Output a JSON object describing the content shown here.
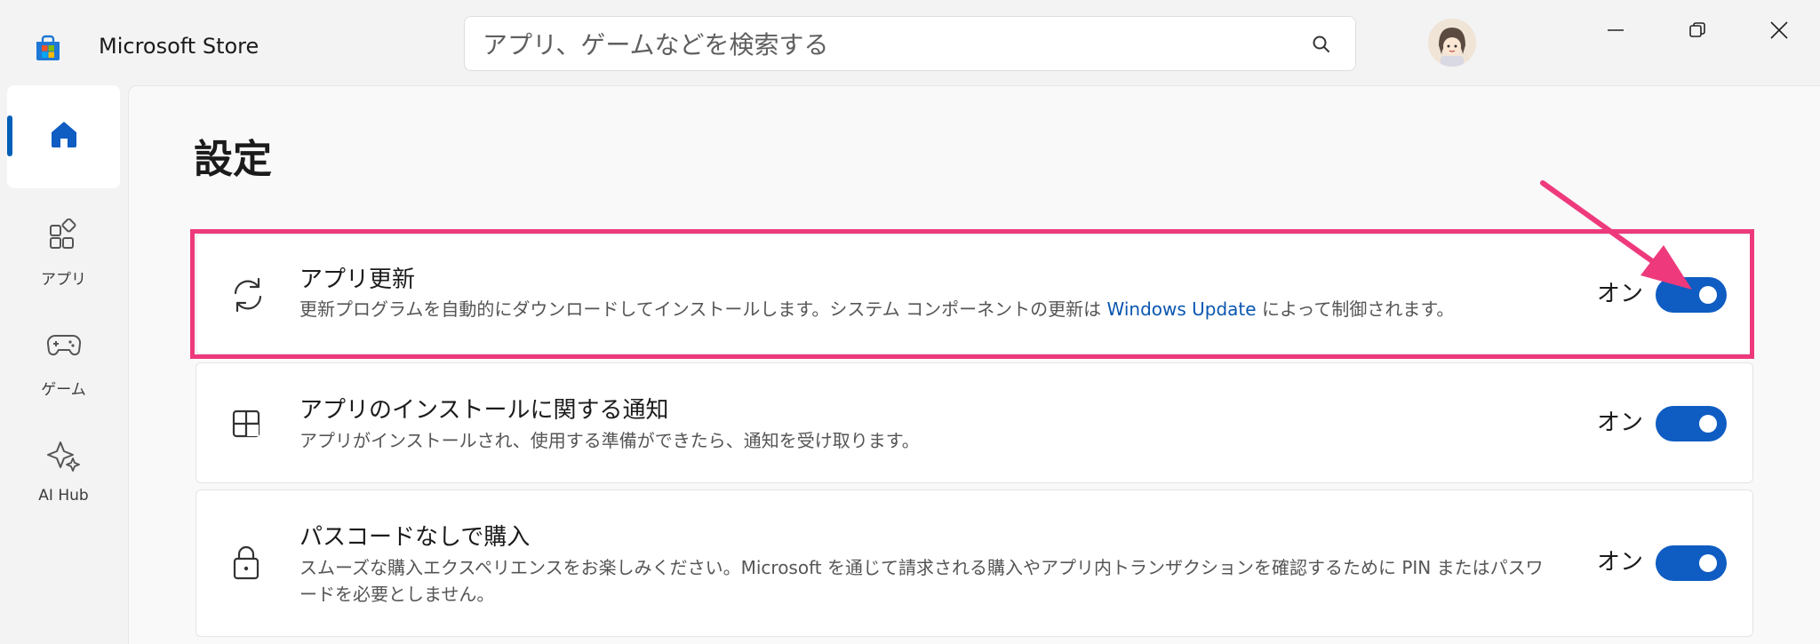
{
  "app": {
    "title": "Microsoft Store"
  },
  "search": {
    "placeholder": "アプリ、ゲームなどを検索する"
  },
  "nav": {
    "items": [
      {
        "label": ""
      },
      {
        "label": "アプリ"
      },
      {
        "label": "ゲーム"
      },
      {
        "label": "AI Hub"
      }
    ]
  },
  "page": {
    "title": "設定"
  },
  "settings": [
    {
      "title": "アプリ更新",
      "desc_before": "更新プログラムを自動的にダウンロードしてインストールします。システム コンポーネントの更新は ",
      "desc_link": "Windows Update",
      "desc_after": " によって制御されます。",
      "state": "オン"
    },
    {
      "title": "アプリのインストールに関する通知",
      "desc": "アプリがインストールされ、使用する準備ができたら、通知を受け取ります。",
      "state": "オン"
    },
    {
      "title": "パスコードなしで購入",
      "desc": "スムーズな購入エクスペリエンスをお楽しみください。Microsoft を通じて請求される購入やアプリ内トランザクションを確認するために PIN またはパスワードを必要としません。",
      "state": "オン"
    }
  ],
  "colors": {
    "accent": "#0f5cc2",
    "highlight": "#ee3a7c",
    "link": "#0a56b0"
  }
}
